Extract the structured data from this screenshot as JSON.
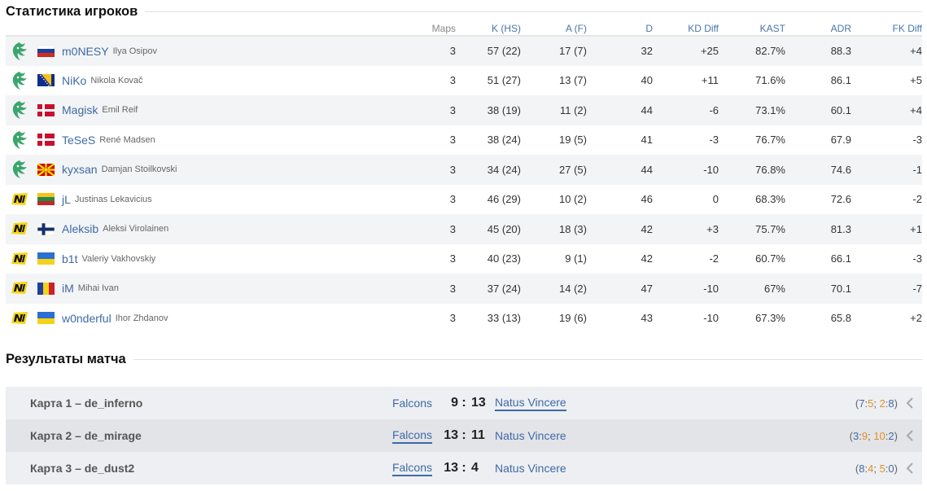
{
  "stats_section": {
    "title": "Статистика игроков"
  },
  "stats_table": {
    "headers": {
      "maps": "Maps",
      "kills": "K (HS)",
      "assists": "A (F)",
      "deaths": "D",
      "kd_diff": "KD Diff",
      "kast": "KAST",
      "adr": "ADR",
      "fk_diff": "FK Diff"
    },
    "rows": [
      {
        "team": "falcons",
        "flag": "ru",
        "nick": "m0NESY",
        "name": "Ilya Osipov",
        "maps": "3",
        "k": "57 (22)",
        "a": "17 (7)",
        "d": "32",
        "kd": "+25",
        "kast": "82.7%",
        "adr": "88.3",
        "fk": "+4"
      },
      {
        "team": "falcons",
        "flag": "ba",
        "nick": "NiKo",
        "name": "Nikola Kovač",
        "maps": "3",
        "k": "51 (27)",
        "a": "13 (7)",
        "d": "40",
        "kd": "+11",
        "kast": "71.6%",
        "adr": "86.1",
        "fk": "+5"
      },
      {
        "team": "falcons",
        "flag": "dk",
        "nick": "Magisk",
        "name": "Emil Reif",
        "maps": "3",
        "k": "38 (19)",
        "a": "11 (2)",
        "d": "44",
        "kd": "-6",
        "kast": "73.1%",
        "adr": "60.1",
        "fk": "+4"
      },
      {
        "team": "falcons",
        "flag": "dk",
        "nick": "TeSeS",
        "name": "René Madsen",
        "maps": "3",
        "k": "38 (24)",
        "a": "19 (5)",
        "d": "41",
        "kd": "-3",
        "kast": "76.7%",
        "adr": "67.9",
        "fk": "-3"
      },
      {
        "team": "falcons",
        "flag": "mk",
        "nick": "kyxsan",
        "name": "Damjan Stoilkovski",
        "maps": "3",
        "k": "34 (24)",
        "a": "27 (5)",
        "d": "44",
        "kd": "-10",
        "kast": "76.8%",
        "adr": "74.6",
        "fk": "-1"
      },
      {
        "team": "navi",
        "flag": "lt",
        "nick": "jL",
        "name": "Justinas Lekavicius",
        "maps": "3",
        "k": "46 (29)",
        "a": "10 (2)",
        "d": "46",
        "kd": "0",
        "kast": "68.3%",
        "adr": "72.6",
        "fk": "-2"
      },
      {
        "team": "navi",
        "flag": "fi",
        "nick": "Aleksib",
        "name": "Aleksi Virolainen",
        "maps": "3",
        "k": "45 (20)",
        "a": "18 (3)",
        "d": "42",
        "kd": "+3",
        "kast": "75.7%",
        "adr": "81.3",
        "fk": "+1"
      },
      {
        "team": "navi",
        "flag": "ua",
        "nick": "b1t",
        "name": "Valeriy Vakhovskiy",
        "maps": "3",
        "k": "40 (23)",
        "a": "9 (1)",
        "d": "42",
        "kd": "-2",
        "kast": "60.7%",
        "adr": "66.1",
        "fk": "-3"
      },
      {
        "team": "navi",
        "flag": "ro",
        "nick": "iM",
        "name": "Mihai Ivan",
        "maps": "3",
        "k": "37 (24)",
        "a": "14 (2)",
        "d": "47",
        "kd": "-10",
        "kast": "67%",
        "adr": "70.1",
        "fk": "-7"
      },
      {
        "team": "navi",
        "flag": "ua",
        "nick": "w0nderful",
        "name": "Ihor Zhdanov",
        "maps": "3",
        "k": "33 (13)",
        "a": "19 (6)",
        "d": "43",
        "kd": "-10",
        "kast": "67.3%",
        "adr": "65.8",
        "fk": "+2"
      }
    ]
  },
  "results_section": {
    "title": "Результаты матча"
  },
  "results": [
    {
      "map": "Карта 1 – de_inferno",
      "team1": "Falcons",
      "score1": "9",
      "sep": ":",
      "score2": "13",
      "team2": "Natus Vincere",
      "winner": 2,
      "h1a": "7",
      "h1b": "5",
      "h2a": "2",
      "h2b": "8"
    },
    {
      "map": "Карта 2 – de_mirage",
      "team1": "Falcons",
      "score1": "13",
      "sep": ":",
      "score2": "11",
      "team2": "Natus Vincere",
      "winner": 1,
      "h1a": "3",
      "h1b": "9",
      "h2a": "10",
      "h2b": "2"
    },
    {
      "map": "Карта 3 – de_dust2",
      "team1": "Falcons",
      "score1": "13",
      "sep": ":",
      "score2": "4",
      "team2": "Natus Vincere",
      "winner": 1,
      "h1a": "8",
      "h1b": "4",
      "h2a": "5",
      "h2b": "0"
    }
  ],
  "colors": {
    "link": "#3f6aa6",
    "positive": "#56a84b",
    "negative": "#e04f40",
    "ct_side": "#3f6aa6",
    "t_side": "#e39021",
    "falcons_green": "#3aa66b",
    "navi_yellow": "#f5d516"
  },
  "icons": {
    "falcons": "falcons-logo-icon",
    "navi": "navi-logo-icon",
    "expand": "chevron-left-icon"
  }
}
